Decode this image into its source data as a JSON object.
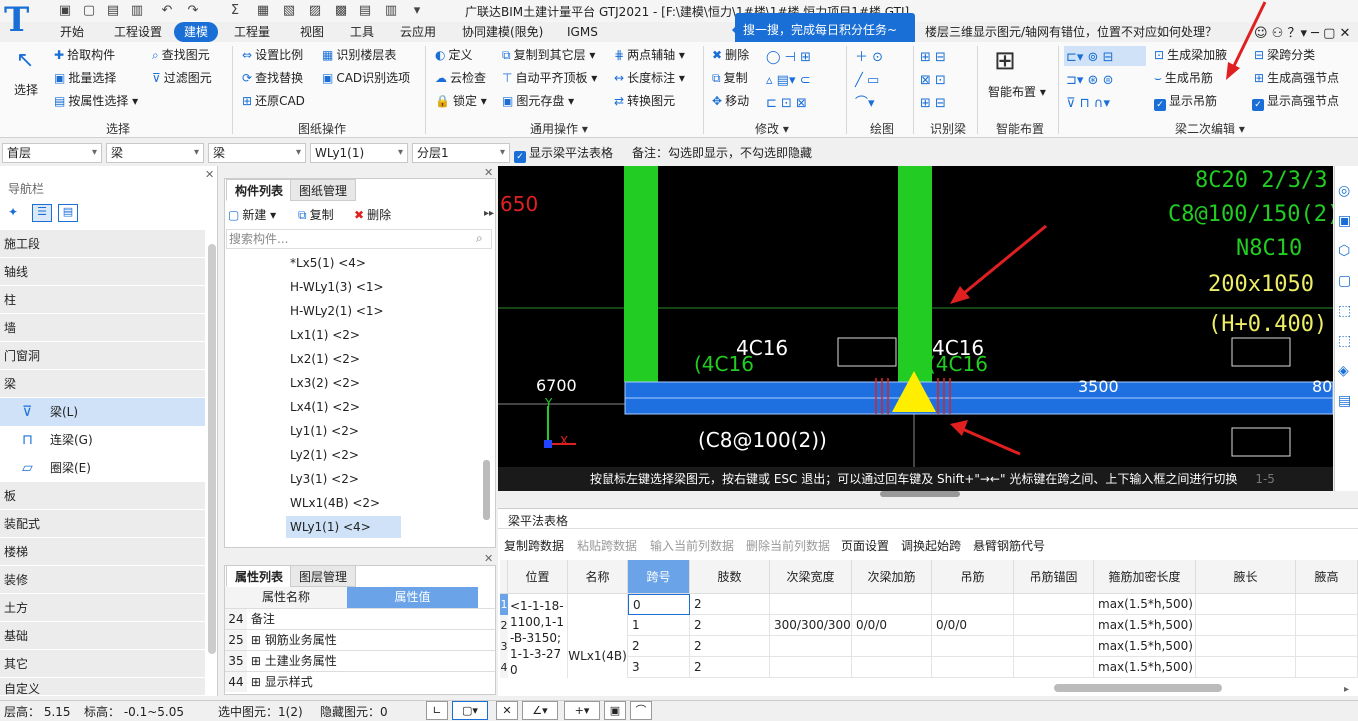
{
  "app": {
    "title": "广联达BIM土建计量平台 GTJ2021 - [F:\\建模\\恒力\\1#楼\\1#楼 恒力项目1#楼.GTJ]",
    "logo_text": "T"
  },
  "menu": [
    "开始",
    "工程设置",
    "建模",
    "工程量",
    "视图",
    "工具",
    "云应用",
    "协同建模(限免)",
    "IGMS"
  ],
  "menu_active": "建模",
  "tip": "搜一搜，完成每日积分任务~",
  "help_question": "楼层三维显示图元/轴网有错位，位置不对应如何处理？",
  "ribbon": {
    "select": {
      "big": "选择",
      "items": [
        "拾取构件",
        "批量选择",
        "按属性选择",
        "查找图元",
        "过滤图元"
      ],
      "group": "选择"
    },
    "drawing": {
      "items": [
        "设置比例",
        "识别楼层表",
        "查找替换",
        "CAD识别选项",
        "还原CAD"
      ],
      "group": "图纸操作"
    },
    "common": {
      "items": [
        "定义",
        "复制到其它层",
        "两点辅轴",
        "云检查",
        "自动平齐顶板",
        "长度标注",
        "锁定",
        "图元存盘",
        "转换图元"
      ],
      "group": "通用操作"
    },
    "modify": {
      "items": [
        "删除",
        "复制",
        "移动"
      ],
      "group": "修改"
    },
    "draw": {
      "group": "绘图"
    },
    "identify": {
      "group": "识别梁"
    },
    "smart": {
      "big": "智能布置",
      "group": "智能布置"
    },
    "beam2": {
      "items": [
        "生成梁加腋",
        "梁跨分类",
        "生成吊筋",
        "生成高强节点",
        "显示吊筋",
        "显示高强节点"
      ],
      "group": "梁二次编辑"
    }
  },
  "filters": {
    "floor": "首层",
    "type": "梁",
    "subtype": "梁",
    "name": "WLy1(1)",
    "layer": "分层1",
    "show_table_label": "显示梁平法表格",
    "note": "备注：勾选即显示，不勾选即隐藏"
  },
  "nav": {
    "title": "导航栏",
    "items": [
      "施工段",
      "轴线",
      "柱",
      "墙",
      "门窗洞",
      "梁",
      "板",
      "装配式",
      "楼梯",
      "装修",
      "土方",
      "基础",
      "其它",
      "自定义"
    ],
    "beam_children": [
      "梁(L)",
      "连梁(G)",
      "圈梁(E)"
    ]
  },
  "components": {
    "tabs": [
      "构件列表",
      "图纸管理"
    ],
    "toolbar": [
      "新建",
      "复制",
      "删除"
    ],
    "search_placeholder": "搜索构件...",
    "items": [
      "*Lx5(1) <4>",
      "H-WLy1(3) <1>",
      "H-WLy2(1) <1>",
      "Lx1(1) <2>",
      "Lx2(1) <2>",
      "Lx3(2) <2>",
      "Lx4(1) <2>",
      "Ly1(1) <2>",
      "Ly2(1) <2>",
      "Ly3(1) <2>",
      "WLx1(4B) <2>",
      "WLy1(1) <4>"
    ],
    "selected": "WLy1(1) <4>"
  },
  "props": {
    "tabs": [
      "属性列表",
      "图层管理"
    ],
    "headers": [
      "属性名称",
      "属性值"
    ],
    "rows": [
      {
        "n": "24",
        "name": "备注"
      },
      {
        "n": "25",
        "name": "钢筋业务属性"
      },
      {
        "n": "35",
        "name": "土建业务属性"
      },
      {
        "n": "44",
        "name": "显示样式"
      }
    ]
  },
  "canvas": {
    "texts": [
      "8C20 2/3/3",
      "C8@100/150(2)",
      "N8C10",
      "200x1050",
      "(H+0.400)",
      "4C16",
      "(4C16",
      "4C16",
      "(4C16",
      "6700",
      "3500",
      "80",
      "(C8@100(2))",
      "650"
    ],
    "hint": "按鼠标左键选择梁图元，按右键或 ESC 退出；可以通过回车键及 Shift+\"→←\" 光标键在跨之间、上下输入框之间进行切换",
    "tail": "1-5"
  },
  "beam_table": {
    "title": "梁平法表格",
    "toolbar": [
      "复制跨数据",
      "粘贴跨数据",
      "输入当前列数据",
      "删除当前列数据",
      "页面设置",
      "调换起始跨",
      "悬臂钢筋代号"
    ],
    "columns": [
      "位置",
      "名称",
      "跨号",
      "肢数",
      "次梁宽度",
      "次梁加筋",
      "吊筋",
      "吊筋锚固",
      "箍筋加密长度",
      "腋长",
      "腋高"
    ],
    "position": "<1-1-18-1100,1-1-B-3150;1-1-3-270",
    "name": "WLx1(4B)",
    "rows": [
      {
        "idx": "1",
        "span": "0",
        "legs": "2",
        "width": "",
        "add": "",
        "hang": "",
        "anchor": "",
        "len": "max(1.5*h,500)"
      },
      {
        "idx": "2",
        "span": "1",
        "legs": "2",
        "width": "300/300/300",
        "add": "0/0/0",
        "hang": "0/0/0",
        "anchor": "",
        "len": "max(1.5*h,500)"
      },
      {
        "idx": "3",
        "span": "2",
        "legs": "2",
        "width": "",
        "add": "",
        "hang": "",
        "anchor": "",
        "len": "max(1.5*h,500)"
      },
      {
        "idx": "4",
        "span": "3",
        "legs": "2",
        "width": "",
        "add": "",
        "hang": "",
        "anchor": "",
        "len": "max(1.5*h,500)"
      }
    ]
  },
  "status": {
    "floor_h": "层高：  5.15",
    "elev": "标高：  -0.1~5.05",
    "selected": "选中图元：1(2)",
    "hidden": "隐藏图元：0"
  }
}
